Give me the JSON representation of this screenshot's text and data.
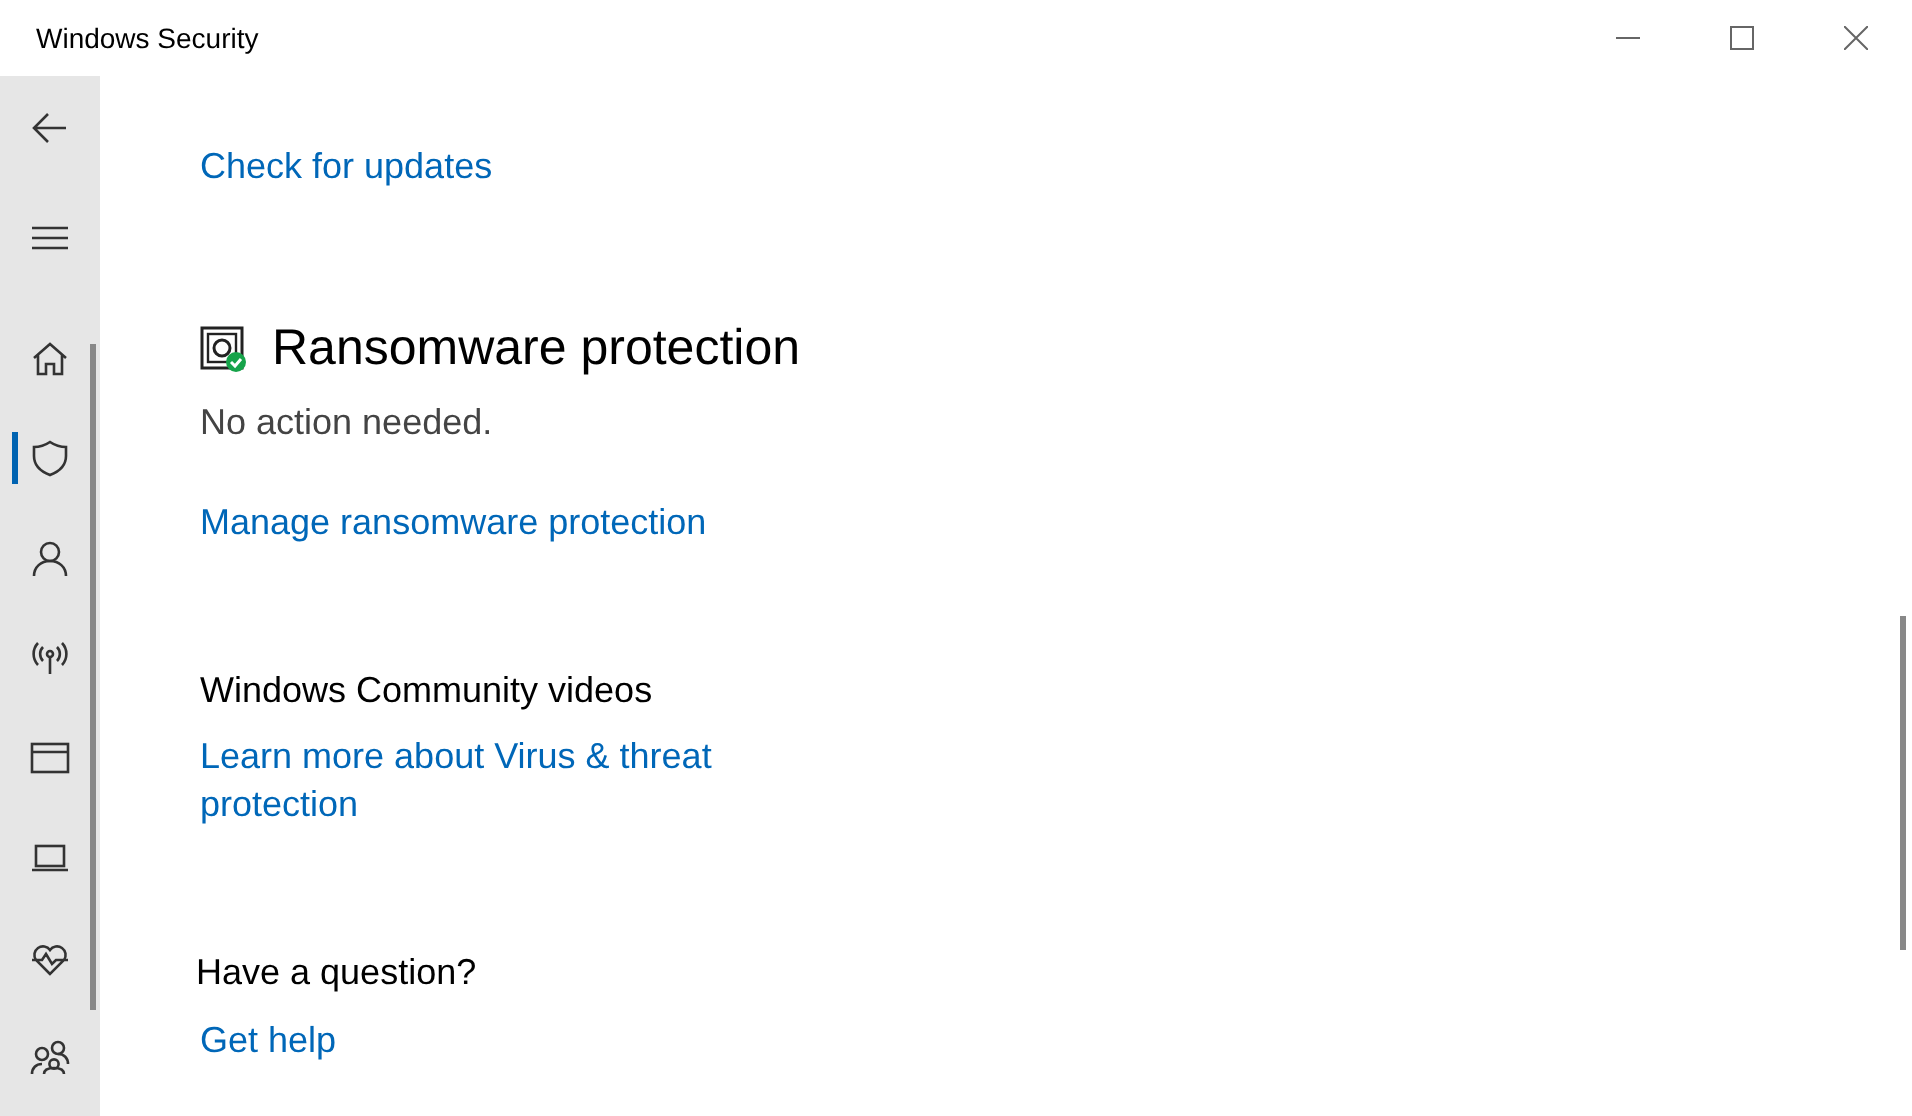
{
  "window": {
    "title": "Windows Security"
  },
  "nav": [
    {
      "kind": "back",
      "selected": false
    },
    {
      "kind": "menu",
      "selected": false
    },
    {
      "kind": "home",
      "selected": false
    },
    {
      "kind": "shield",
      "selected": true
    },
    {
      "kind": "person",
      "selected": false
    },
    {
      "kind": "antenna",
      "selected": false
    },
    {
      "kind": "window",
      "selected": false
    },
    {
      "kind": "laptop",
      "selected": false
    },
    {
      "kind": "heart",
      "selected": false
    },
    {
      "kind": "family",
      "selected": false
    }
  ],
  "content": {
    "check_link": "Check for updates",
    "ransomware": {
      "title": "Ransomware protection",
      "status": "No action needed.",
      "link": "Manage ransomware protection"
    },
    "community": {
      "heading": "Windows Community videos",
      "link": "Learn more about Virus & threat protection"
    },
    "help": {
      "heading": "Have a question?",
      "link": "Get help"
    }
  }
}
